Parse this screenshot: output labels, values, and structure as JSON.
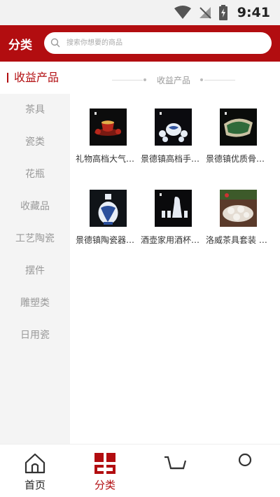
{
  "status_bar": {
    "time": "9:41"
  },
  "header": {
    "title": "分类",
    "search_placeholder": "搜索你想要的商品"
  },
  "sidebar": {
    "items": [
      {
        "label": "收益产品",
        "active": true
      },
      {
        "label": "茶具"
      },
      {
        "label": "瓷类"
      },
      {
        "label": "花瓶"
      },
      {
        "label": "收藏品"
      },
      {
        "label": "工艺陶瓷"
      },
      {
        "label": "摆件"
      },
      {
        "label": "雕塑类"
      },
      {
        "label": "日用瓷"
      }
    ]
  },
  "content": {
    "section_title": "收益产品",
    "products": [
      {
        "name": "礼物高档大气…"
      },
      {
        "name": "景德镇高档手…"
      },
      {
        "name": "景德镇优质骨…"
      },
      {
        "name": "景德镇陶瓷器…"
      },
      {
        "name": "酒壶家用酒杯…"
      },
      {
        "name": "洛威茶具套装 …"
      }
    ]
  },
  "tabbar": {
    "tabs": [
      {
        "label": "首页"
      },
      {
        "label": "分类",
        "active": true
      },
      {
        "label": ""
      },
      {
        "label": ""
      }
    ]
  },
  "colors": {
    "brand": "#b20d10"
  }
}
